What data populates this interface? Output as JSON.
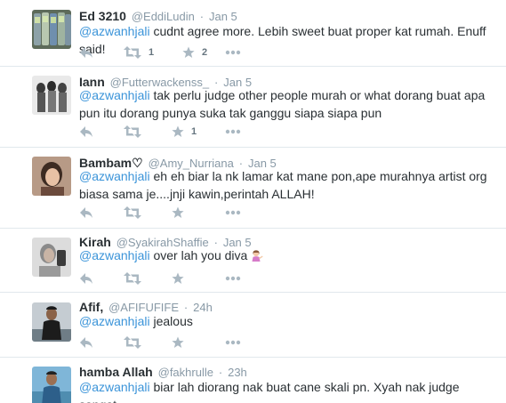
{
  "tweets": [
    {
      "fullname": "Ed 3210",
      "username": "@EddiLudin",
      "sep": "·",
      "time": "Jan 5",
      "mention": "@azwanhjali",
      "text": " cudnt agree more. Lebih sweet buat proper kat rumah. Enuff said!",
      "retweets": "1",
      "favorites": "2",
      "avatar": "phones"
    },
    {
      "fullname": "Iann",
      "username": "@Futterwackenss_",
      "sep": "·",
      "time": "Jan 5",
      "mention": "@azwanhjali",
      "text": " tak perlu judge other people murah or what dorang buat apa pun itu dorang punya suka tak ganggu siapa siapa pun",
      "retweets": "",
      "favorites": "1",
      "avatar": "figures"
    },
    {
      "fullname": "Bambam♡",
      "username": "@Amy_Nurriana",
      "sep": "·",
      "time": "Jan 5",
      "mention": "@azwanhjali",
      "text": " eh eh biar la nk lamar kat mane pon,ape murahnya artist org biasa sama je....jnji kawin,perintah ALLAH!",
      "retweets": "",
      "favorites": "",
      "avatar": "girl"
    },
    {
      "fullname": "Kirah",
      "username": "@SyakirahShaffie",
      "sep": "·",
      "time": "Jan 5",
      "mention": "@azwanhjali",
      "text": " over lah you diva ",
      "retweets": "",
      "favorites": "",
      "avatar": "selfie",
      "emoji": "information-desk-person-emoji"
    },
    {
      "fullname": "Afif,",
      "username": "@AFIFUFIFE",
      "sep": "·",
      "time": "24h",
      "mention": "@azwanhjali",
      "text": " jealous",
      "retweets": "",
      "favorites": "",
      "avatar": "boy"
    },
    {
      "fullname": "hamba Allah",
      "username": "@fakhrulle",
      "sep": "·",
      "time": "23h",
      "mention": "@azwanhjali",
      "text": " biar lah diorang nak buat cane skali pn. Xyah nak judge sangat.",
      "retweets": "",
      "favorites": "",
      "avatar": "man"
    }
  ],
  "icons": {
    "reply": "reply-icon",
    "retweet": "retweet-icon",
    "favorite": "star-icon",
    "more": "more-dots-icon"
  },
  "colors": {
    "mention": "#3b94d9",
    "meta": "#8899a6",
    "action": "#aab8c2",
    "divider": "#e1e8ed"
  }
}
